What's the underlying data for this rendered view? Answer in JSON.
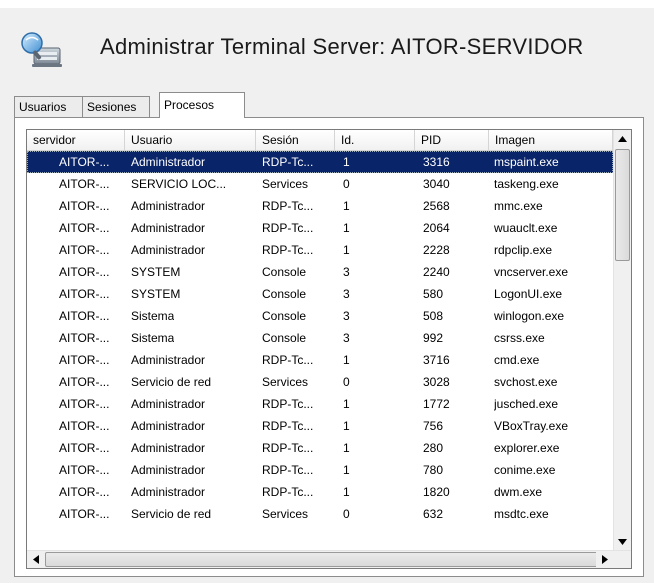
{
  "window": {
    "title": "Administrar Terminal Server: AITOR-SERVIDOR",
    "top_fragment": "",
    "icon": "terminal-server-icon"
  },
  "tabs": [
    {
      "label": "Usuarios",
      "active": false
    },
    {
      "label": "Sesiones",
      "active": false
    },
    {
      "label": "Procesos",
      "active": true
    }
  ],
  "table": {
    "columns": [
      "servidor",
      "Usuario",
      "Sesión",
      "Id.",
      "PID",
      "Imagen"
    ],
    "rows": [
      {
        "servidor": "AITOR-...",
        "usuario": "Administrador",
        "sesion": "RDP-Tc...",
        "id": "1",
        "pid": "3316",
        "imagen": "mspaint.exe",
        "selected": true
      },
      {
        "servidor": "AITOR-...",
        "usuario": "SERVICIO LOC...",
        "sesion": "Services",
        "id": "0",
        "pid": "3040",
        "imagen": "taskeng.exe"
      },
      {
        "servidor": "AITOR-...",
        "usuario": "Administrador",
        "sesion": "RDP-Tc...",
        "id": "1",
        "pid": "2568",
        "imagen": "mmc.exe"
      },
      {
        "servidor": "AITOR-...",
        "usuario": "Administrador",
        "sesion": "RDP-Tc...",
        "id": "1",
        "pid": "2064",
        "imagen": "wuauclt.exe"
      },
      {
        "servidor": "AITOR-...",
        "usuario": "Administrador",
        "sesion": "RDP-Tc...",
        "id": "1",
        "pid": "2228",
        "imagen": "rdpclip.exe"
      },
      {
        "servidor": "AITOR-...",
        "usuario": "SYSTEM",
        "sesion": "Console",
        "id": "3",
        "pid": "2240",
        "imagen": "vncserver.exe"
      },
      {
        "servidor": "AITOR-...",
        "usuario": "SYSTEM",
        "sesion": "Console",
        "id": "3",
        "pid": "580",
        "imagen": "LogonUI.exe"
      },
      {
        "servidor": "AITOR-...",
        "usuario": "Sistema",
        "sesion": "Console",
        "id": "3",
        "pid": "508",
        "imagen": "winlogon.exe"
      },
      {
        "servidor": "AITOR-...",
        "usuario": "Sistema",
        "sesion": "Console",
        "id": "3",
        "pid": "992",
        "imagen": "csrss.exe"
      },
      {
        "servidor": "AITOR-...",
        "usuario": "Administrador",
        "sesion": "RDP-Tc...",
        "id": "1",
        "pid": "3716",
        "imagen": "cmd.exe"
      },
      {
        "servidor": "AITOR-...",
        "usuario": "Servicio de red",
        "sesion": "Services",
        "id": "0",
        "pid": "3028",
        "imagen": "svchost.exe"
      },
      {
        "servidor": "AITOR-...",
        "usuario": "Administrador",
        "sesion": "RDP-Tc...",
        "id": "1",
        "pid": "1772",
        "imagen": "jusched.exe"
      },
      {
        "servidor": "AITOR-...",
        "usuario": "Administrador",
        "sesion": "RDP-Tc...",
        "id": "1",
        "pid": "756",
        "imagen": "VBoxTray.exe"
      },
      {
        "servidor": "AITOR-...",
        "usuario": "Administrador",
        "sesion": "RDP-Tc...",
        "id": "1",
        "pid": "280",
        "imagen": "explorer.exe"
      },
      {
        "servidor": "AITOR-...",
        "usuario": "Administrador",
        "sesion": "RDP-Tc...",
        "id": "1",
        "pid": "780",
        "imagen": "conime.exe"
      },
      {
        "servidor": "AITOR-...",
        "usuario": "Administrador",
        "sesion": "RDP-Tc...",
        "id": "1",
        "pid": "1820",
        "imagen": "dwm.exe"
      },
      {
        "servidor": "AITOR-...",
        "usuario": "Servicio de red",
        "sesion": "Services",
        "id": "0",
        "pid": "632",
        "imagen": "msdtc.exe"
      }
    ]
  },
  "scrollbars": {
    "vertical": {
      "up_icon": "scroll-up-arrow-icon",
      "down_icon": "scroll-down-arrow-icon"
    },
    "horizontal": {
      "left_icon": "scroll-left-arrow-icon",
      "right_icon": "scroll-right-arrow-icon"
    }
  },
  "colors": {
    "selection": "#0a246a",
    "window_bg": "#f0f0f0",
    "list_bg": "#ffffff"
  }
}
